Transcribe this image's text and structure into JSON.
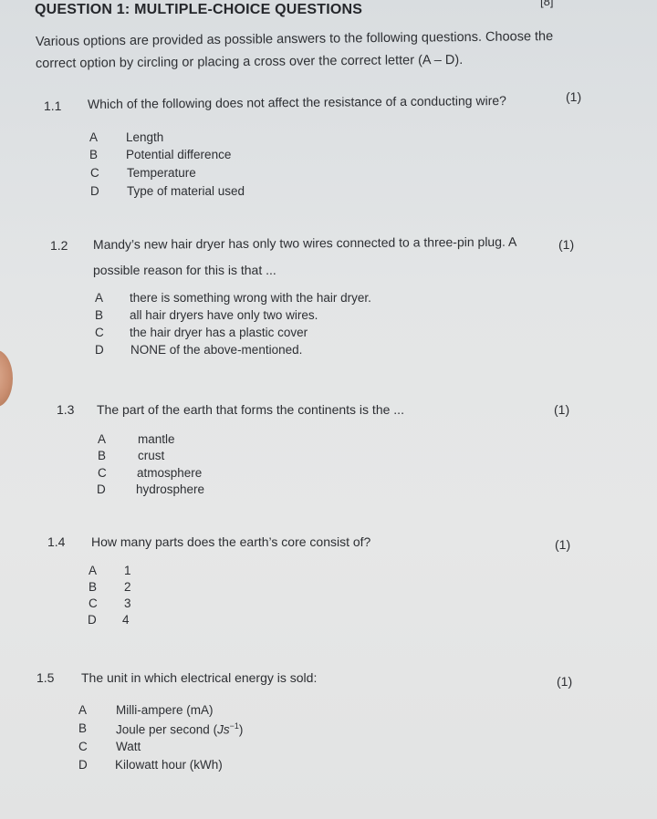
{
  "header": {
    "title": "QUESTION 1: MULTIPLE-CHOICE QUESTIONS",
    "total_marks": "[8]",
    "instructions_line1": "Various options are provided as possible answers to the following questions. Choose the",
    "instructions_line2": "correct option by circling or placing a cross over the correct letter (A – D)."
  },
  "questions": [
    {
      "number": "1.1",
      "text": "Which of the following does not affect the resistance of a conducting wire?",
      "marks": "(1)",
      "options": [
        {
          "letter": "A",
          "text": "Length"
        },
        {
          "letter": "B",
          "text": "Potential difference"
        },
        {
          "letter": "C",
          "text": "Temperature"
        },
        {
          "letter": "D",
          "text": "Type of material used"
        }
      ]
    },
    {
      "number": "1.2",
      "text": "Mandy’s new hair dryer has only two wires connected to a three-pin plug. A",
      "text_line2": "possible reason for this is that ...",
      "marks": "(1)",
      "options": [
        {
          "letter": "A",
          "text": "there is something wrong with the hair dryer."
        },
        {
          "letter": "B",
          "text": "all hair dryers have only two wires."
        },
        {
          "letter": "C",
          "text": "the hair dryer has a plastic cover"
        },
        {
          "letter": "D",
          "text": "NONE of the above-mentioned."
        }
      ]
    },
    {
      "number": "1.3",
      "text": "The part of the earth that forms the continents is the ...",
      "marks": "(1)",
      "options": [
        {
          "letter": "A",
          "text": "mantle"
        },
        {
          "letter": "B",
          "text": "crust"
        },
        {
          "letter": "C",
          "text": "atmosphere"
        },
        {
          "letter": "D",
          "text": "hydrosphere"
        }
      ]
    },
    {
      "number": "1.4",
      "text": "How many parts does the earth’s core consist of?",
      "marks": "(1)",
      "options": [
        {
          "letter": "A",
          "text": "1"
        },
        {
          "letter": "B",
          "text": "2"
        },
        {
          "letter": "C",
          "text": "3"
        },
        {
          "letter": "D",
          "text": "4"
        }
      ]
    },
    {
      "number": "1.5",
      "text": "The unit in which electrical energy is sold:",
      "marks": "(1)",
      "options": [
        {
          "letter": "A",
          "text": "Milli-ampere (mA)"
        },
        {
          "letter": "B",
          "text": "Joule per second (",
          "unit": "Js",
          "sup": "−1",
          "suffix": ")"
        },
        {
          "letter": "C",
          "text": "Watt"
        },
        {
          "letter": "D",
          "text": "Kilowatt hour (kWh)"
        }
      ]
    }
  ]
}
